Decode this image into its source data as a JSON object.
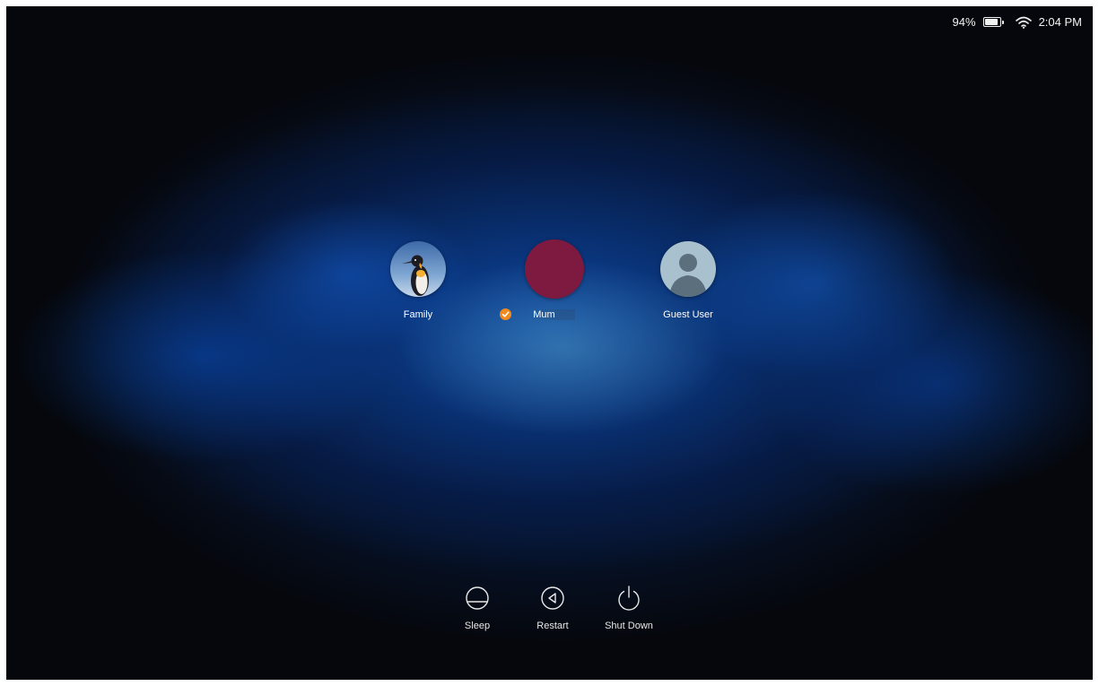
{
  "status_bar": {
    "battery_percent": "94%",
    "battery_level": 0.94,
    "clock": "2:04 PM"
  },
  "users": [
    {
      "name": "Family",
      "avatar": "penguin-photo"
    },
    {
      "name": "Mum",
      "avatar_color": "#7e1940",
      "selected": true
    },
    {
      "name": "Guest User",
      "avatar": "guest-silhouette"
    }
  ],
  "actions": {
    "sleep": "Sleep",
    "restart": "Restart",
    "shutdown": "Shut Down"
  },
  "colors": {
    "accent_badge": "#f28a1e",
    "mum_avatar": "#7e1940"
  }
}
